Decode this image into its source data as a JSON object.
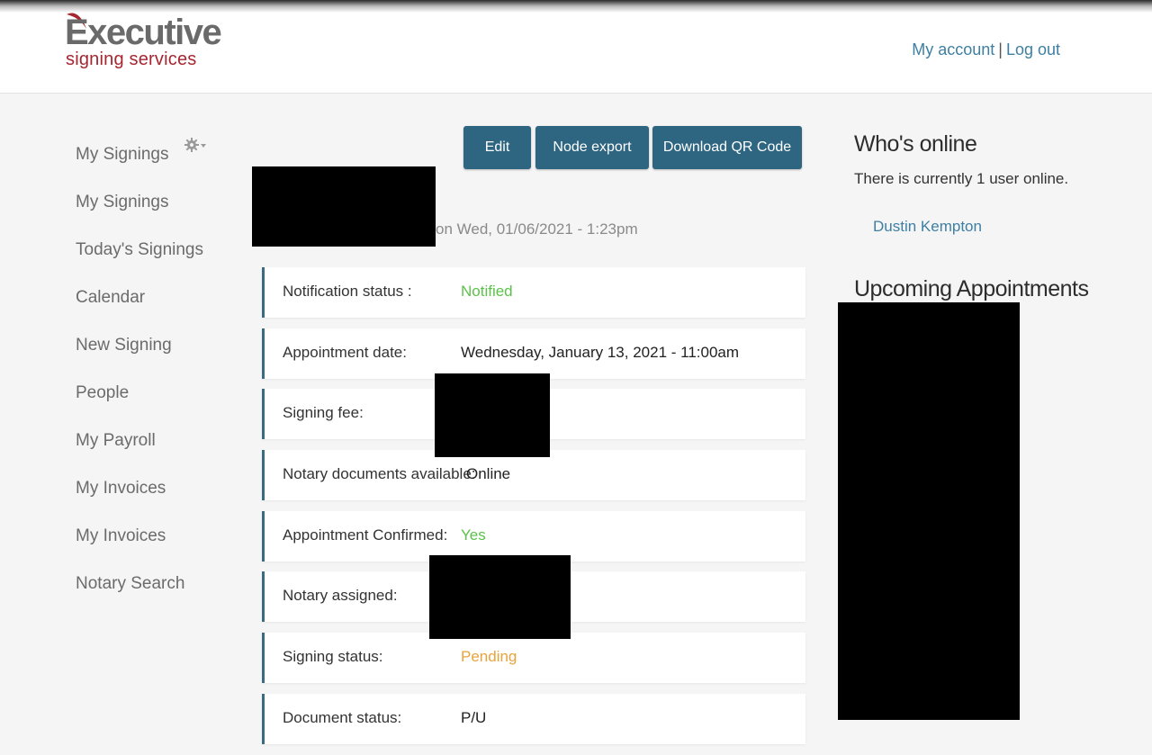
{
  "header": {
    "logo_top": "Executive",
    "logo_bottom": "signing services",
    "my_account": "My account",
    "separator": "|",
    "log_out": "Log out"
  },
  "sidebar": {
    "items": [
      {
        "label": "My Signings"
      },
      {
        "label": "My Signings"
      },
      {
        "label": "Today's Signings"
      },
      {
        "label": "Calendar"
      },
      {
        "label": "New Signing"
      },
      {
        "label": "People"
      },
      {
        "label": "My Payroll"
      },
      {
        "label": "My Invoices"
      },
      {
        "label": "My Invoices"
      },
      {
        "label": "Notary Search"
      }
    ],
    "gear_icon": "gear-dropdown-icon"
  },
  "actions": {
    "edit": "Edit",
    "node_export": "Node export",
    "download_qr": "Download QR Code"
  },
  "submitted": "on Wed, 01/06/2021 - 1:23pm",
  "fields": [
    {
      "label": "Notification status :",
      "value": "Notified",
      "color": "#5cc14a"
    },
    {
      "label": "Appointment date:",
      "value": "Wednesday, January 13, 2021 - 11:00am"
    },
    {
      "label": "Signing fee:",
      "value": ""
    },
    {
      "label": "Notary documents available:",
      "value": "Online"
    },
    {
      "label": "Appointment Confirmed:",
      "value": "Yes",
      "color": "#5cc14a"
    },
    {
      "label": "Notary assigned:",
      "value": ""
    },
    {
      "label": "Signing status:",
      "value": "Pending",
      "color": "#eaa33c"
    },
    {
      "label": "Document status:",
      "value": "P/U"
    }
  ],
  "whos_online": {
    "title": "Who's online",
    "text": "There is currently 1 user online.",
    "users": [
      "Dustin Kempton"
    ]
  },
  "upcoming": {
    "title": "Upcoming Appointments"
  },
  "colors": {
    "button_bg": "#2e6682",
    "link": "#3e7fa3",
    "logo_red": "#a52630",
    "field_border": "#3b6b80"
  }
}
